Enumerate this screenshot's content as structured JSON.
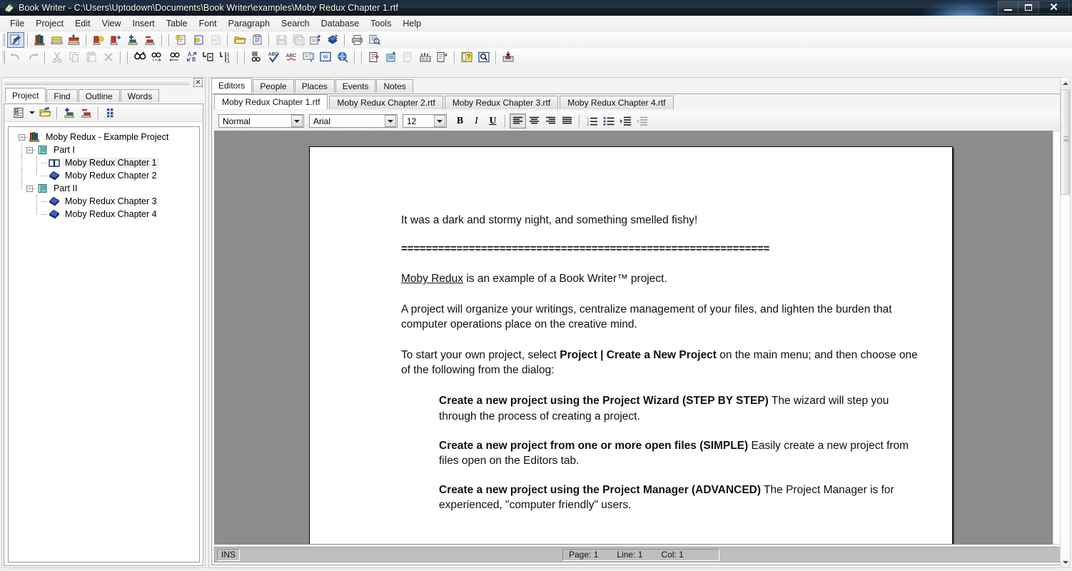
{
  "window": {
    "title": "Book Writer - C:\\Users\\Uptodown\\Documents\\Book Writer\\examples\\Moby Redux Chapter 1.rtf",
    "app_icon": "book-writer-icon",
    "controls": {
      "minimize": "minimize-icon",
      "maximize": "maximize-icon",
      "close": "close-icon"
    }
  },
  "menubar": {
    "items": [
      {
        "label": "File"
      },
      {
        "label": "Project"
      },
      {
        "label": "Edit"
      },
      {
        "label": "View"
      },
      {
        "label": "Insert"
      },
      {
        "label": "Table"
      },
      {
        "label": "Font"
      },
      {
        "label": "Paragraph"
      },
      {
        "label": "Search"
      },
      {
        "label": "Database"
      },
      {
        "label": "Tools"
      },
      {
        "label": "Help"
      }
    ]
  },
  "toolbar_row1": {
    "groups": [
      [
        "project-open-icon"
      ],
      [
        "books-icon",
        "book-stack-icon",
        "book-add-icon"
      ],
      [
        "chapter-new-icon",
        "chapter-add-icon",
        "item-add-icon",
        "item-remove-icon"
      ],
      [
        "new-document-icon",
        "new-from-template-icon",
        "text-document-icon"
      ],
      [
        "open-folder-icon",
        "clipboard-icon"
      ],
      [
        "save-icon",
        "save-all-icon",
        "export-icon",
        "publish-icon"
      ],
      [
        "print-icon",
        "print-preview-icon"
      ]
    ]
  },
  "toolbar_row2": {
    "groups": [
      [
        "undo-icon",
        "redo-icon"
      ],
      [
        "cut-icon",
        "copy-icon",
        "paste-icon",
        "delete-icon"
      ],
      [
        "find-icon",
        "find-next-icon",
        "find-previous-icon",
        "replace-icon",
        "goto-page-icon",
        "goto-line-icon"
      ],
      [
        "link-icon",
        "spellcheck-icon",
        "thesaurus-icon",
        "grammar-icon",
        "word-count-icon",
        "translate-icon"
      ],
      [
        "add-record-icon",
        "import-record-icon",
        "notes-icon",
        "sort-icon",
        "filter-icon"
      ],
      [
        "properties-icon",
        "inspect-icon"
      ],
      [
        "archive-icon"
      ]
    ]
  },
  "left_panel": {
    "close_label": "✕",
    "tabs": [
      {
        "label": "Project",
        "selected": true
      },
      {
        "label": "Find",
        "selected": false
      },
      {
        "label": "Outline",
        "selected": false
      },
      {
        "label": "Words",
        "selected": false
      }
    ],
    "toolbar_icons": [
      "project-view-icon",
      "dropdown-arrow-icon",
      "open-project-icon",
      "add-item-icon",
      "remove-item-icon",
      "arrange-icon"
    ],
    "tree": [
      {
        "label": "Moby Redux - Example Project",
        "depth": 0,
        "icon": "project-books-icon",
        "expander": "-",
        "selected": false
      },
      {
        "label": "Part I",
        "depth": 1,
        "icon": "part-book-icon",
        "expander": "-",
        "selected": false
      },
      {
        "label": "Moby Redux Chapter 1",
        "depth": 2,
        "icon": "open-book-icon",
        "expander": "",
        "selected": true
      },
      {
        "label": "Moby Redux Chapter 2",
        "depth": 2,
        "icon": "chapter-diamond-icon",
        "expander": "",
        "selected": false
      },
      {
        "label": "Part II",
        "depth": 1,
        "icon": "part-book-icon",
        "expander": "-",
        "selected": false
      },
      {
        "label": "Moby Redux Chapter 3",
        "depth": 2,
        "icon": "chapter-diamond-icon",
        "expander": "",
        "selected": false
      },
      {
        "label": "Moby Redux Chapter 4",
        "depth": 2,
        "icon": "chapter-diamond-icon",
        "expander": "",
        "selected": false
      }
    ]
  },
  "main": {
    "top_tabs": [
      {
        "label": "Editors",
        "selected": true
      },
      {
        "label": "People",
        "selected": false
      },
      {
        "label": "Places",
        "selected": false
      },
      {
        "label": "Events",
        "selected": false
      },
      {
        "label": "Notes",
        "selected": false
      }
    ],
    "document_tabs": [
      {
        "label": "Moby Redux Chapter 1.rtf",
        "selected": true
      },
      {
        "label": "Moby Redux Chapter 2.rtf",
        "selected": false
      },
      {
        "label": "Moby Redux Chapter 3.rtf",
        "selected": false
      },
      {
        "label": "Moby Redux Chapter 4.rtf",
        "selected": false
      }
    ],
    "format_toolbar": {
      "style": {
        "value": "Normal"
      },
      "font": {
        "value": "Arial"
      },
      "size": {
        "value": "12"
      },
      "bold": "B",
      "italic": "I",
      "underline": "U",
      "align_left": "align-left-icon",
      "align_center": "align-center-icon",
      "align_right": "align-right-icon",
      "align_justify": "align-justify-icon",
      "numbered_list": "numbered-list-icon",
      "bullet_list": "bullet-list-icon",
      "indent_increase": "indent-increase-icon",
      "indent_decrease": "indent-decrease-icon"
    },
    "document": {
      "paragraphs": [
        {
          "type": "plain",
          "text": "It was a dark and stormy night, and something smelled fishy!"
        },
        {
          "type": "rule",
          "text": "============================================================"
        },
        {
          "type": "rich_underline_lead",
          "lead": "Moby Redux",
          "rest": " is an example of a Book Writer™ project."
        },
        {
          "type": "plain",
          "text": "A project will organize your writings, centralize management of your files, and lighten the burden that computer operations place on the creative mind."
        },
        {
          "type": "rich_bold_mid",
          "before": "To start your own project, select ",
          "bold": "Project | Create a New Project",
          "after": " on the main menu; and then choose one of the following from the dialog:"
        },
        {
          "type": "indent_bold_lead",
          "bold": "Create a new project using the Project Wizard (STEP BY STEP)",
          "rest": "  The wizard will step you through the process of creating a project."
        },
        {
          "type": "indent_bold_lead",
          "bold": "Create a new project from one or more open files (SIMPLE)",
          "rest": "  Easily create a new project from files open on the Editors tab."
        },
        {
          "type": "indent_bold_lead",
          "bold": "Create a new project using the Project Manager (ADVANCED)",
          "rest": "  The Project Manager is for experienced, \"computer friendly\" users."
        }
      ]
    },
    "statusbar": {
      "mode": "INS",
      "page": "Page: 1",
      "line": "Line: 1",
      "col": "Col: 1"
    }
  },
  "colors": {
    "titlebar": "#16222e",
    "page_background": "#8c8c8c",
    "page": "#ffffff",
    "accent_blue": "#2b4ea8",
    "selection": "#eeeeee"
  }
}
